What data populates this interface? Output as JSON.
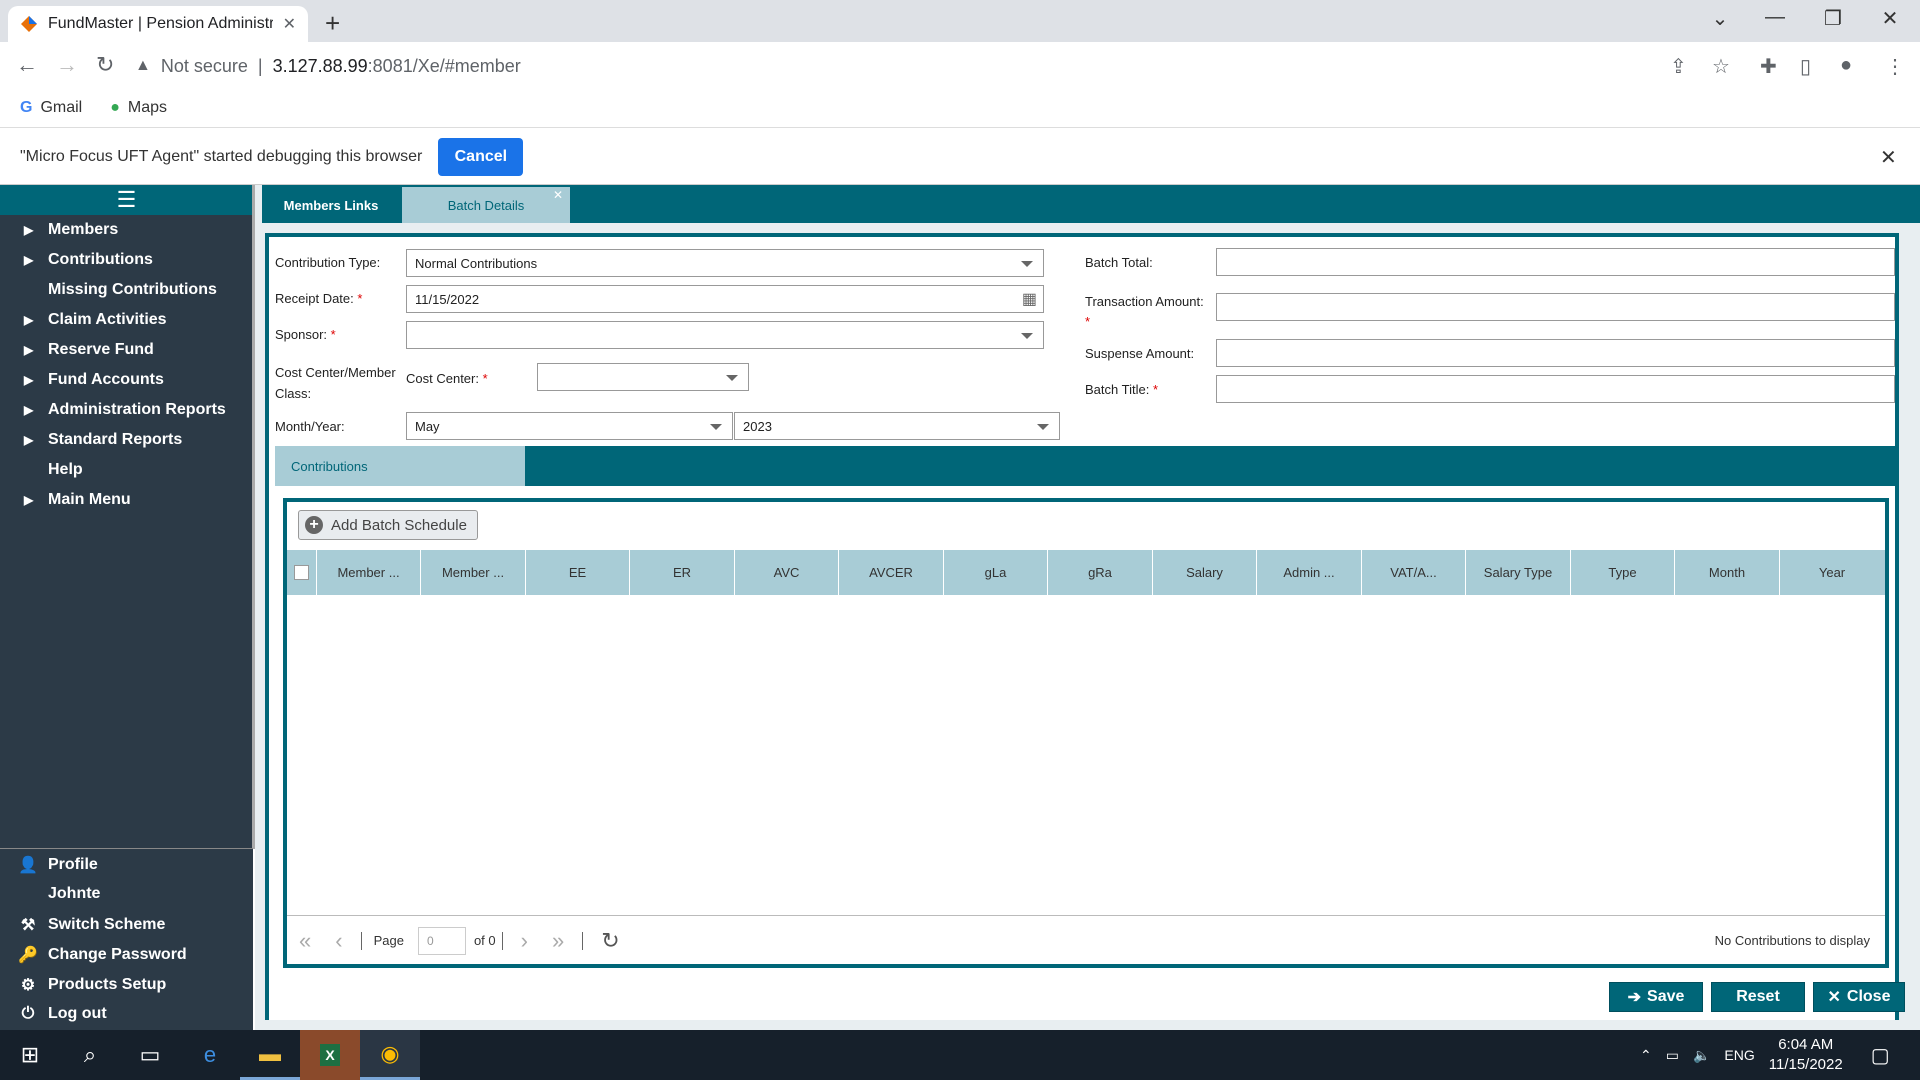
{
  "browser": {
    "tab_title": "FundMaster | Pension Administra",
    "address": {
      "security": "Not secure",
      "host": "3.127.88.99",
      "path": ":8081/Xe/#member"
    },
    "bookmarks": [
      "Gmail",
      "Maps"
    ],
    "infobar": {
      "message": "\"Micro Focus UFT Agent\" started debugging this browser",
      "cancel_label": "Cancel"
    }
  },
  "sidebar": {
    "menu_icon": "hamburger-icon",
    "items": [
      {
        "label": "Members",
        "expandable": true
      },
      {
        "label": "Contributions",
        "expandable": true
      },
      {
        "label": "Missing Contributions",
        "expandable": false
      },
      {
        "label": "Claim Activities",
        "expandable": true
      },
      {
        "label": "Reserve Fund",
        "expandable": true
      },
      {
        "label": "Fund Accounts",
        "expandable": true
      },
      {
        "label": "Administration Reports",
        "expandable": true
      },
      {
        "label": "Standard Reports",
        "expandable": true
      },
      {
        "label": "Help",
        "expandable": false
      },
      {
        "label": "Main Menu",
        "expandable": true
      }
    ],
    "bottom": [
      {
        "label": "Profile",
        "icon": "user-icon"
      },
      {
        "label": "Johnte",
        "icon": ""
      },
      {
        "label": "Switch Scheme",
        "icon": "switch-icon"
      },
      {
        "label": "Change Password",
        "icon": "key-icon"
      },
      {
        "label": "Products Setup",
        "icon": "gears-icon"
      },
      {
        "label": "Log out",
        "icon": "power-icon"
      }
    ]
  },
  "tabs": {
    "members_links": "Members Links",
    "batch_details": "Batch Details"
  },
  "form": {
    "contribution_type_label": "Contribution Type:",
    "contribution_type_value": "Normal Contributions",
    "receipt_date_label": "Receipt Date:",
    "receipt_date_value": "11/15/2022",
    "sponsor_label": "Sponsor:",
    "sponsor_value": "",
    "cost_center_member_class_label": "Cost Center/Member Class:",
    "cost_center_label": "Cost Center:",
    "cost_center_value": "",
    "month_year_label": "Month/Year:",
    "month_value": "May",
    "year_value": "2023",
    "batch_total_label": "Batch Total:",
    "batch_total_value": "",
    "transaction_amount_label": "Transaction Amount:",
    "transaction_amount_value": "",
    "suspense_amount_label": "Suspense Amount:",
    "suspense_amount_value": "",
    "batch_title_label": "Batch Title:",
    "batch_title_value": "",
    "required_mark": "*"
  },
  "contributions": {
    "tab_label": "Contributions",
    "add_button": "Add Batch Schedule",
    "columns": [
      "Member ...",
      "Member ...",
      "EE",
      "ER",
      "AVC",
      "AVCER",
      "gLa",
      "gRa",
      "Salary",
      "Admin ...",
      "VAT/A...",
      "Salary Type",
      "Type",
      "Month",
      "Year"
    ],
    "pager": {
      "page_label": "Page",
      "page_value": "0",
      "of_label": "of 0",
      "empty_message": "No Contributions to display"
    }
  },
  "actions": {
    "save": "Save",
    "reset": "Reset",
    "close": "Close"
  },
  "taskbar": {
    "language": "ENG",
    "time": "6:04 AM",
    "date": "11/15/2022"
  },
  "colors": {
    "accent": "#006678",
    "light_accent": "#a8ccd6",
    "sidebar_bg": "#2c3a47",
    "required": "#dd0000"
  }
}
